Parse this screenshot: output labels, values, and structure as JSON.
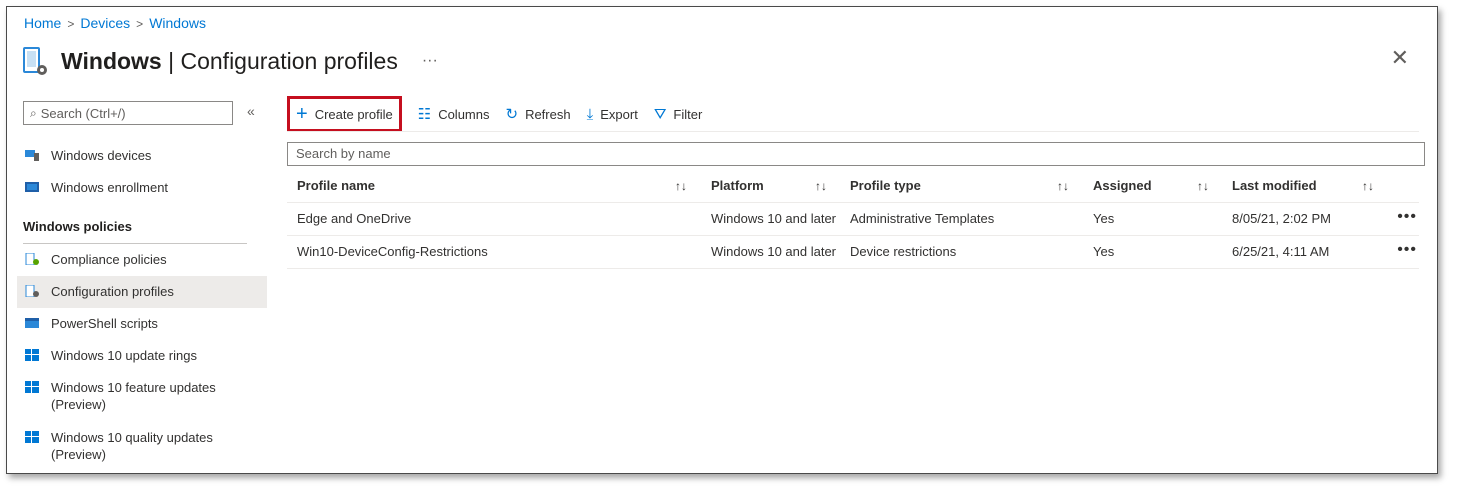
{
  "breadcrumb": [
    "Home",
    "Devices",
    "Windows"
  ],
  "header": {
    "title_bold": "Windows",
    "title_rest": " | Configuration profiles",
    "more": "···",
    "close": "✕"
  },
  "sidebar": {
    "search_placeholder": "Search (Ctrl+/)",
    "collapse": "«",
    "items_top": [
      {
        "label": "Windows devices",
        "icon": "devices-icon"
      },
      {
        "label": "Windows enrollment",
        "icon": "enrollment-icon"
      }
    ],
    "section": "Windows policies",
    "items": [
      {
        "label": "Compliance policies",
        "icon": "compliance-icon"
      },
      {
        "label": "Configuration profiles",
        "icon": "configuration-icon",
        "selected": true
      },
      {
        "label": "PowerShell scripts",
        "icon": "powershell-icon"
      },
      {
        "label": "Windows 10 update rings",
        "icon": "windows-icon"
      },
      {
        "label": "Windows 10 feature updates (Preview)",
        "icon": "windows-icon"
      },
      {
        "label": "Windows 10 quality updates (Preview)",
        "icon": "windows-icon"
      }
    ]
  },
  "toolbar": {
    "create": "Create profile",
    "columns": "Columns",
    "refresh": "Refresh",
    "export": "Export",
    "filter": "Filter"
  },
  "main": {
    "search_placeholder": "Search by name",
    "columns": [
      "Profile name",
      "Platform",
      "Profile type",
      "Assigned",
      "Last modified"
    ],
    "rows": [
      {
        "name": "Edge and OneDrive",
        "platform": "Windows 10 and later",
        "type": "Administrative Templates",
        "assigned": "Yes",
        "modified": "8/05/21, 2:02 PM"
      },
      {
        "name": "Win10-DeviceConfig-Restrictions",
        "platform": "Windows 10 and later",
        "type": "Device restrictions",
        "assigned": "Yes",
        "modified": "6/25/21, 4:11 AM"
      }
    ]
  },
  "colors": {
    "accent": "#0078d4",
    "highlight": "#c50f1f",
    "selected_bg": "#edebe9"
  }
}
